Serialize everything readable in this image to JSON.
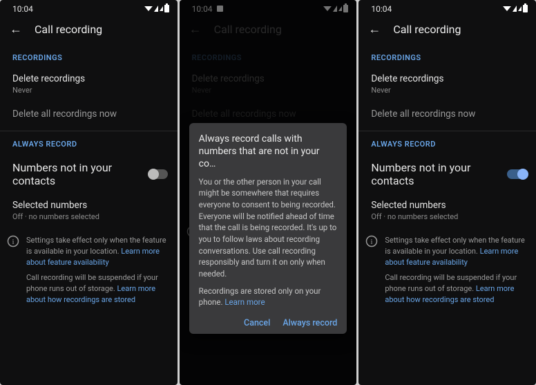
{
  "status": {
    "time": "10:04"
  },
  "pageTitle": "Call recording",
  "sections": {
    "recordings": {
      "header": "RECORDINGS",
      "deleteLabel": "Delete recordings",
      "deleteSub": "Never",
      "deleteAllNow": "Delete all recordings now"
    },
    "always": {
      "header": "ALWAYS RECORD",
      "numbersNotLabel": "Numbers not in your contacts",
      "selectedLabel": "Selected numbers",
      "selectedSub": "Off · no numbers selected"
    }
  },
  "info": {
    "line1a": "Settings take effect only when the feature is available in your location. ",
    "line1link": "Learn more about feature availability",
    "line2a": "Call recording will be suspended if your phone runs out of storage. ",
    "line2link": "Learn more about how recordings are stored"
  },
  "dialog": {
    "title": "Always record calls with numbers that are not in your co…",
    "body1": "You or the other person in your call might be somewhere that requires everyone to consent to being recorded. Everyone will be notified ahead of time that the call is being recorded. It's up to you to follow laws about recording conversations. Use call recording responsibly and turn it on only when needed.",
    "body2a": "Recordings are stored only on your phone. ",
    "body2link": "Learn more",
    "cancel": "Cancel",
    "confirm": "Always record"
  }
}
